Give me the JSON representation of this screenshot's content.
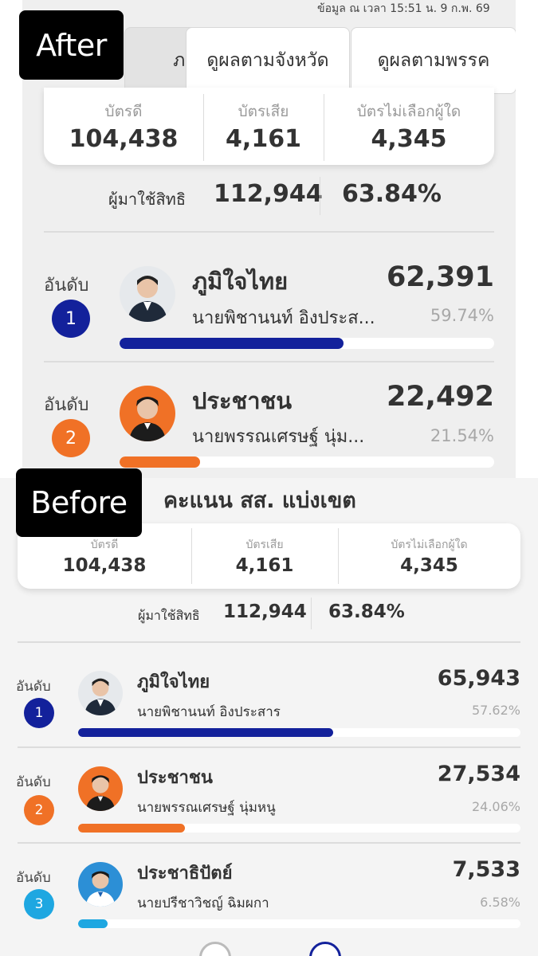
{
  "after": {
    "tag": "After",
    "timestamp": "ข้อมูล ณ เวลา 15:51 น. 9 ก.พ. 69",
    "tabs": [
      "ภาพรวม",
      "ดูผลตามจังหวัด",
      "ดูผลตามพรรค"
    ],
    "stats": [
      {
        "label": "บัตรดี",
        "value": "104,438"
      },
      {
        "label": "บัตรเสีย",
        "value": "4,161"
      },
      {
        "label": "บัตรไม่เลือกผู้ใด",
        "value": "4,345"
      }
    ],
    "turnout_label": "ผู้มาใช้สิทธิ",
    "turnout_value": "112,944",
    "turnout_pct": "63.84%",
    "rank_word": "อันดับ",
    "results": [
      {
        "rank": "1",
        "party": "ภูมิใจไทย",
        "candidate": "นายพิชานนท์ อิงประส...",
        "votes": "62,391",
        "pct": "59.74%",
        "share": 0.5974,
        "color": "#13219b"
      },
      {
        "rank": "2",
        "party": "ประชาชน",
        "candidate": "นายพรรณเศรษฐ์ นุ่ม...",
        "votes": "22,492",
        "pct": "21.54%",
        "share": 0.2154,
        "color": "#f07126"
      }
    ]
  },
  "before": {
    "tag": "Before",
    "title": "คะแนน สส. แบ่งเขต",
    "stats": [
      {
        "label": "บัตรดี",
        "value": "104,438"
      },
      {
        "label": "บัตรเสีย",
        "value": "4,161"
      },
      {
        "label": "บัตรไม่เลือกผู้ใด",
        "value": "4,345"
      }
    ],
    "turnout_label": "ผู้มาใช้สิทธิ",
    "turnout_value": "112,944",
    "turnout_pct": "63.84%",
    "rank_word": "อันดับ",
    "results": [
      {
        "rank": "1",
        "party": "ภูมิใจไทย",
        "candidate": "นายพิชานนท์ อิงประสาร",
        "votes": "65,943",
        "pct": "57.62%",
        "share": 0.5762,
        "color": "#13219b"
      },
      {
        "rank": "2",
        "party": "ประชาชน",
        "candidate": "นายพรรณเศรษฐ์ นุ่มหนู",
        "votes": "27,534",
        "pct": "24.06%",
        "share": 0.2406,
        "color": "#f07126"
      },
      {
        "rank": "3",
        "party": "ประชาธิปัตย์",
        "candidate": "นายปรีชาวิชญ์ ฉิมผกา",
        "votes": "7,533",
        "pct": "6.58%",
        "share": 0.0658,
        "color": "#1ea7e1"
      }
    ]
  }
}
